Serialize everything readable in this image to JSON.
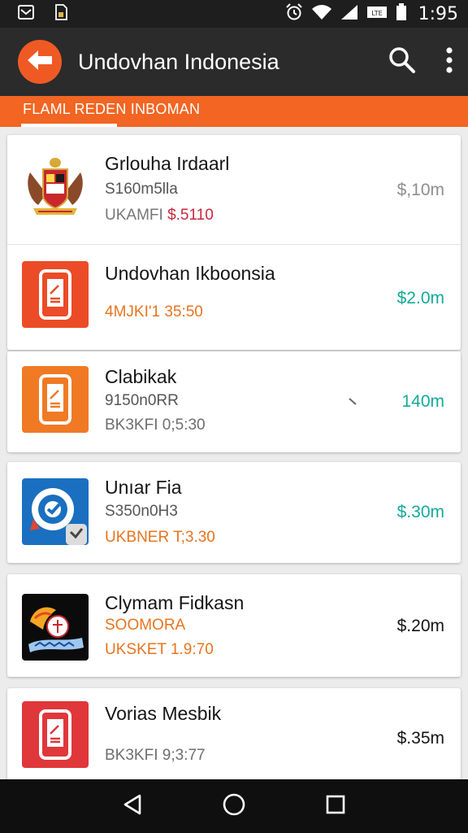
{
  "status_bar": {
    "time": "1:95",
    "icons": [
      "inbox-icon",
      "sim-icon",
      "alarm-icon",
      "wifi-icon",
      "signal-icon",
      "battery-icon"
    ]
  },
  "app_bar": {
    "title": "Undovhan Indonesia",
    "accent_color": "#ef5a24",
    "icons": [
      "back-arrow-icon",
      "search-icon",
      "more-vert-icon"
    ]
  },
  "tabs": [
    {
      "label": "FLAML REDEN INBOMAN",
      "selected": true
    }
  ],
  "items": [
    {
      "title": "Grlouha Irdaarl",
      "subtitle": "S160m5lla",
      "meta_prefix": "UKAMFI ",
      "meta_value": "$.5110",
      "meta_value_color": "#c8283d",
      "meta_prefix_color": "#777777",
      "price": "$,10m",
      "price_color": "#8e8e8e",
      "icon": "coat-of-arms-icon"
    },
    {
      "title": "Undovhan Ikboonsia",
      "subtitle": "",
      "meta_prefix": "4MJKI'1 35:50",
      "meta_value": "",
      "meta_prefix_color": "#e8741f",
      "price": "$2.0m",
      "price_color": "#14a99a",
      "icon": "phone-document-icon"
    },
    {
      "title": "Clabikak",
      "subtitle": "9150n0RR",
      "meta_prefix": "BK3KFI 0;5:30",
      "meta_value": "",
      "meta_prefix_color": "#6e6e6e",
      "price": "140m",
      "price_color": "#14a99a",
      "icon": "phone-document-icon"
    },
    {
      "title": "Unıar Fia",
      "subtitle": "S350n0H3",
      "meta_prefix": "UKBNER T;3.30",
      "meta_value": "",
      "meta_prefix_color": "#e8741f",
      "price": "$.30m",
      "price_color": "#14a99a",
      "icon": "target-badge-icon"
    },
    {
      "title": "Clymam Fidkasn",
      "subtitle": "SOOMORA",
      "subtitle_color": "#e8741f",
      "meta_prefix": "UKSKET 1.9:70",
      "meta_value": "",
      "meta_prefix_color": "#e8741f",
      "price": "$.20m",
      "price_color": "#151515",
      "icon": "garuda-emblem-icon"
    },
    {
      "title": "Vorias Mesbik",
      "subtitle": "",
      "meta_prefix": "BK3KFI 9;3:77",
      "meta_value": "",
      "meta_prefix_color": "#6e6e6e",
      "price": "$.35m",
      "price_color": "#151515",
      "icon": "phone-document-icon"
    }
  ],
  "nav_bar": {
    "icons": [
      "back-triangle-icon",
      "home-circle-icon",
      "recents-square-icon"
    ]
  }
}
